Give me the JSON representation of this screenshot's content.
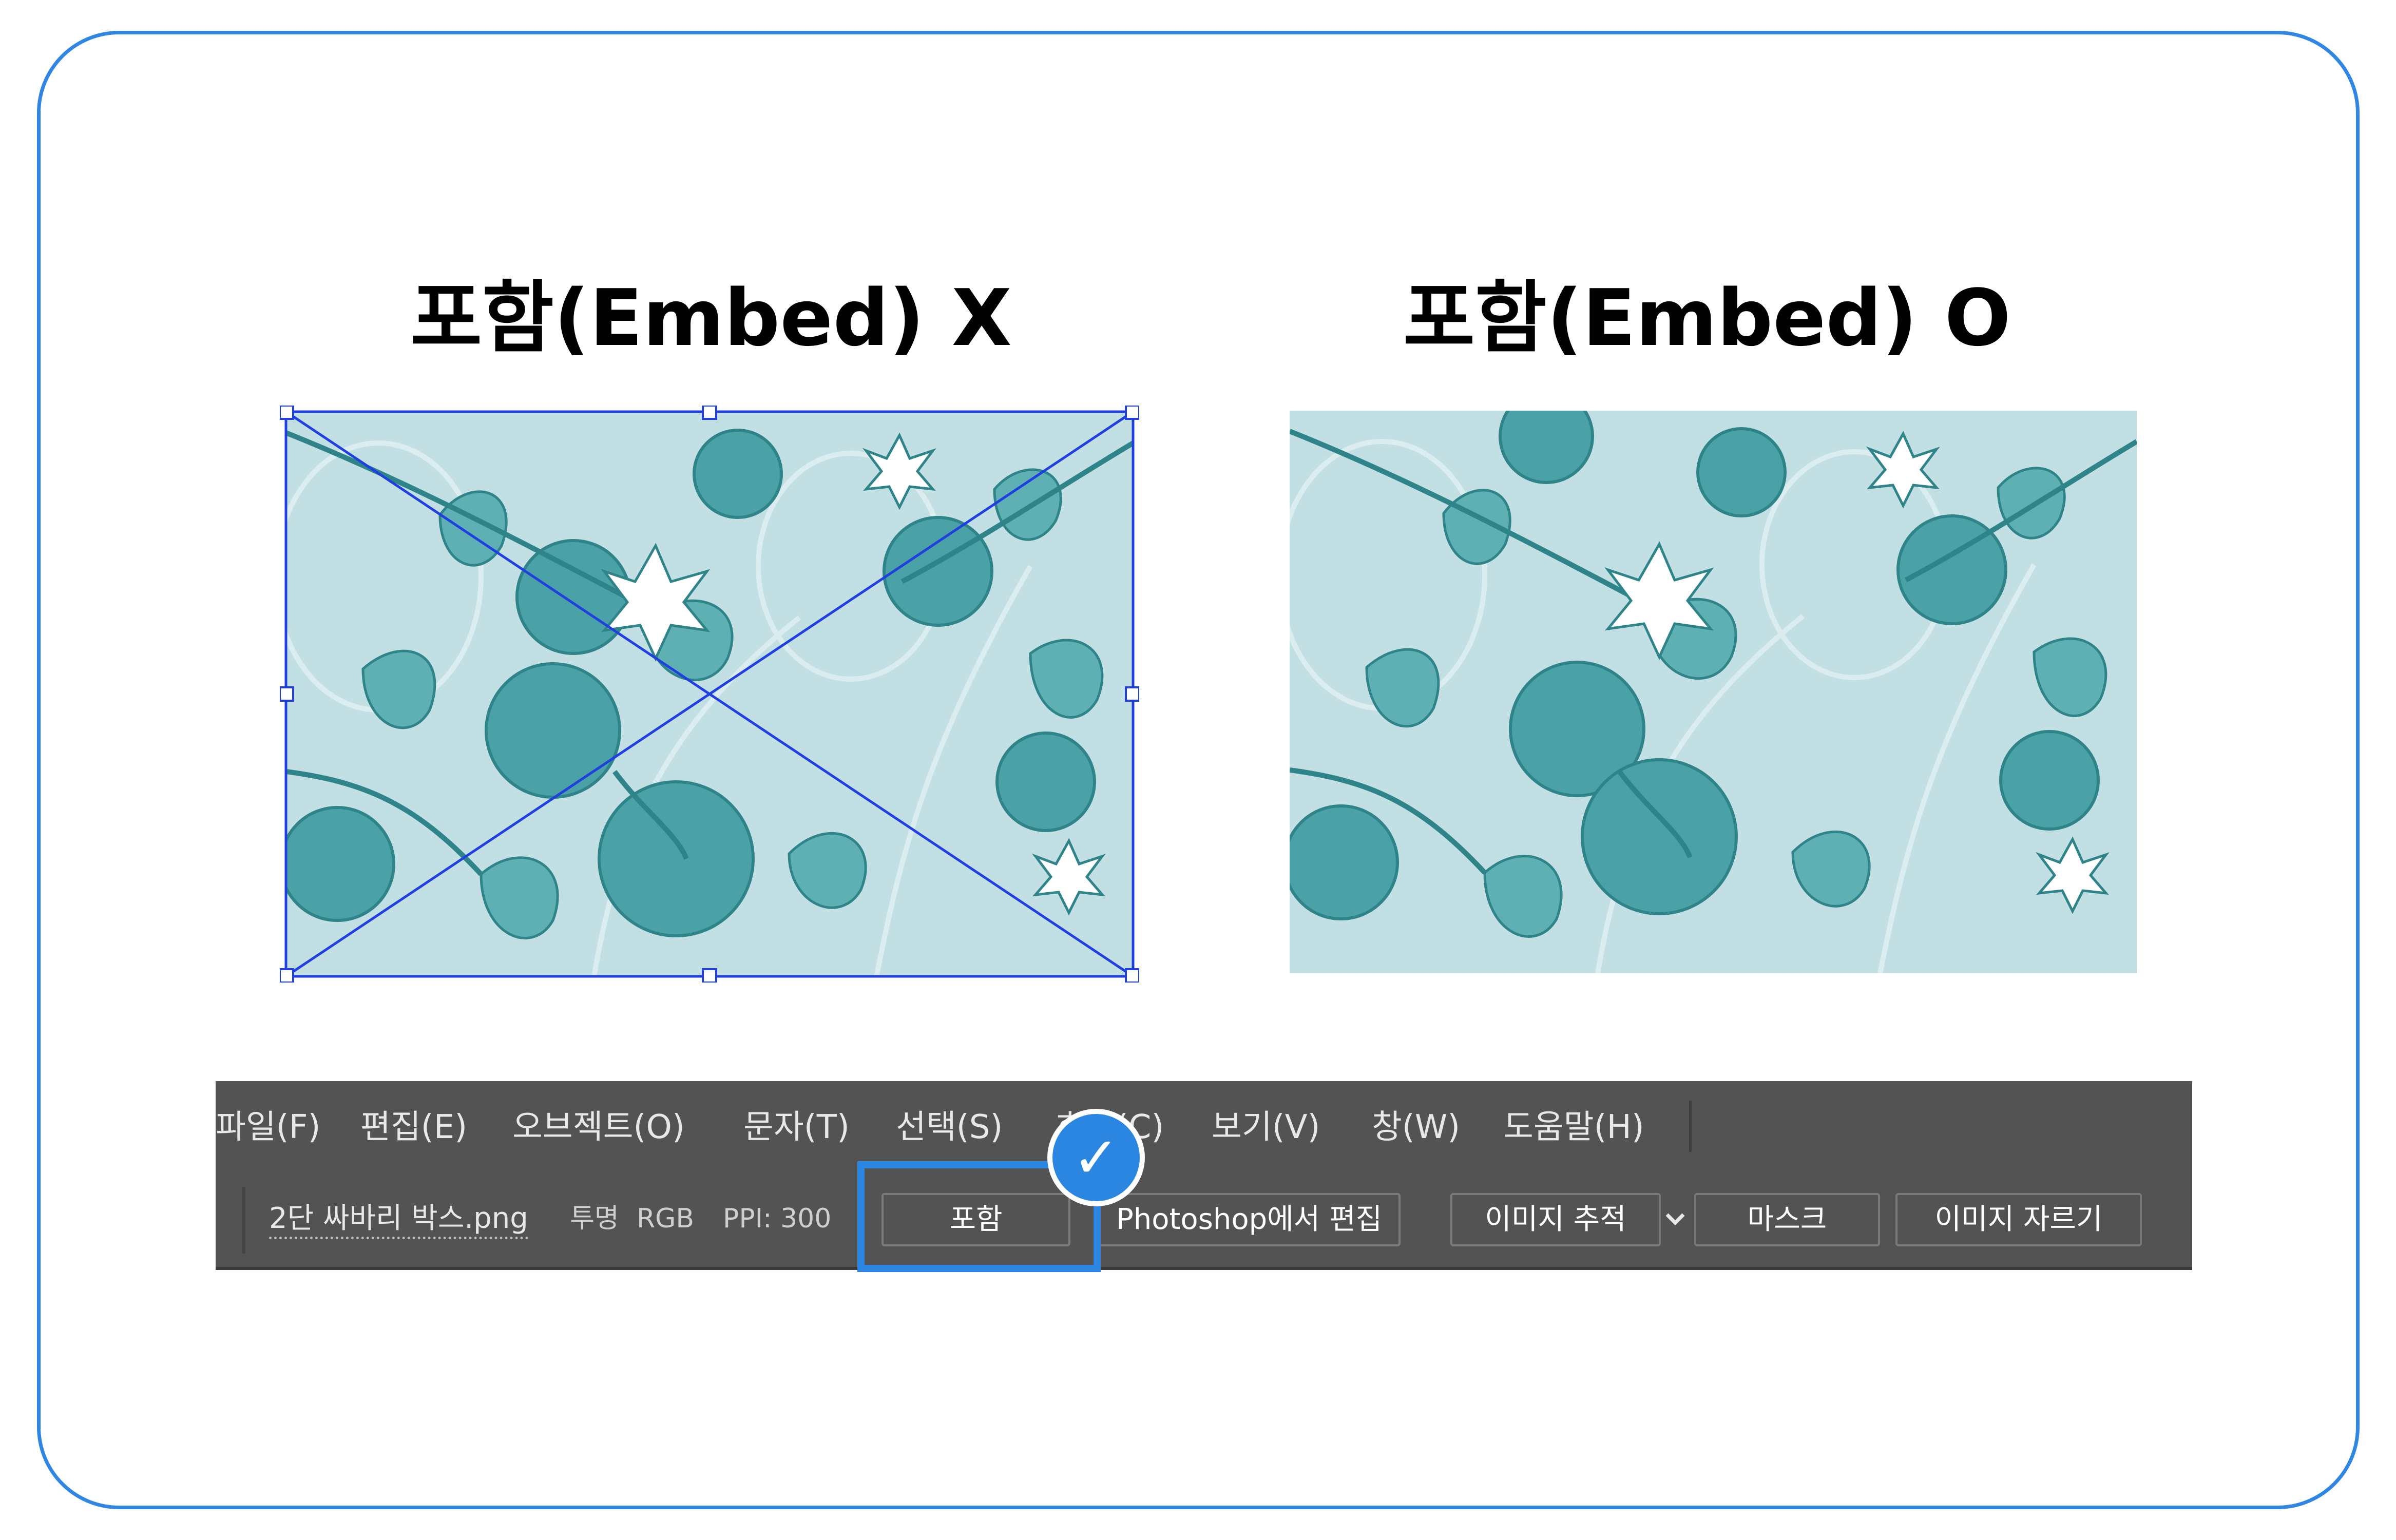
{
  "titles": {
    "left": "포함(Embed) X",
    "right": "포함(Embed) O"
  },
  "menubar": {
    "items": [
      "파일(F)",
      "편집(E)",
      "오브젝트(O)",
      "문자(T)",
      "선택(S)",
      "효과(C)",
      "보기(V)",
      "창(W)",
      "도움말(H)"
    ]
  },
  "options_bar": {
    "filename": "2단 싸바리 박스.png",
    "transparency": "투명",
    "color_mode": "RGB",
    "ppi": "PPI: 300",
    "buttons": {
      "embed": "포함",
      "edit_in_photoshop": "Photoshop에서 편집",
      "image_trace": "이미지 추적",
      "mask": "마스크",
      "crop_image": "이미지 자르기"
    }
  },
  "colors": {
    "frame_border": "#2f86e3",
    "highlight": "#2b86e2",
    "toolbar_bg": "#535353",
    "pattern_bg": "#c2e0e3",
    "pattern_ink": "#3f9a9e",
    "selection": "#1f3fe0"
  },
  "icons": {
    "check_badge": "check-icon",
    "dropdown": "chevron-down-icon"
  }
}
